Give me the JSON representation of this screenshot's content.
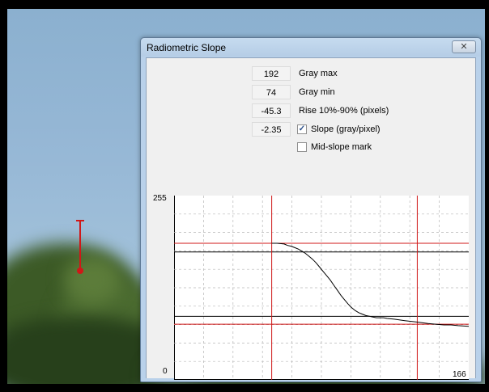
{
  "window": {
    "title": "Radiometric Slope",
    "close_glyph": "✕"
  },
  "fields": {
    "gray_max": {
      "value": "192",
      "label": "Gray max"
    },
    "gray_min": {
      "value": "74",
      "label": "Gray min"
    },
    "rise": {
      "value": "-45.3",
      "label": "Rise 10%-90% (pixels)"
    },
    "slope": {
      "value": "-2.35",
      "label": "Slope (gray/pixel)",
      "checked": true
    },
    "mid_slope": {
      "label": "Mid-slope mark",
      "checked": false
    }
  },
  "colors": {
    "accent_red": "#d01818",
    "curve": "#000000"
  },
  "chart_data": {
    "type": "line",
    "y_tick_labels": [
      "255",
      "0"
    ],
    "x_tick_labels": [
      "0",
      "166"
    ],
    "xlim": [
      0,
      166
    ],
    "ylim": [
      0,
      255
    ],
    "grid": true,
    "red_horizontal_lines": [
      189,
      77
    ],
    "black_horizontal_lines": [
      177,
      88
    ],
    "red_vertical_lines": [
      55,
      137
    ],
    "series": [
      {
        "x": [
          55,
          58,
          62,
          64,
          66,
          68,
          70,
          72,
          74,
          76,
          78,
          80,
          82,
          84,
          86,
          88,
          90,
          92,
          94,
          96,
          98,
          100,
          102,
          104,
          106,
          108,
          110,
          112,
          114,
          116,
          118,
          120,
          124,
          130,
          137,
          140,
          143,
          148,
          152,
          156,
          160,
          166
        ],
        "values": [
          189,
          189,
          188,
          186,
          185,
          183,
          181,
          178,
          175,
          171,
          167,
          162,
          156,
          150,
          144,
          138,
          131,
          124,
          117,
          111,
          105,
          100,
          96,
          93,
          91,
          89,
          88,
          87,
          86,
          86,
          86,
          85,
          84,
          82,
          80,
          79,
          78,
          77,
          76,
          76,
          75,
          74
        ]
      }
    ]
  }
}
